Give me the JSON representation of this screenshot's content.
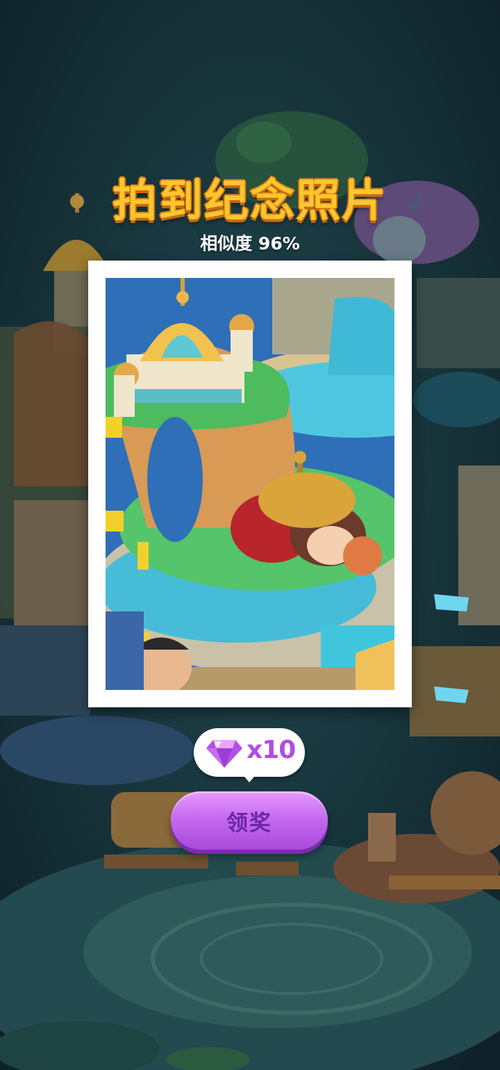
{
  "title": "拍到纪念照片",
  "similarity": {
    "label": "相似度 96%"
  },
  "reward": {
    "icon": "purple-gem-icon",
    "quantity": "x10"
  },
  "claim_button": {
    "label": "领奖"
  },
  "colors": {
    "title": "#ffc62e",
    "title_outline": "#c96a10",
    "button": "#c66af0",
    "button_text": "#6a27a3",
    "reward_text": "#b14de0",
    "background": "#16313a"
  }
}
